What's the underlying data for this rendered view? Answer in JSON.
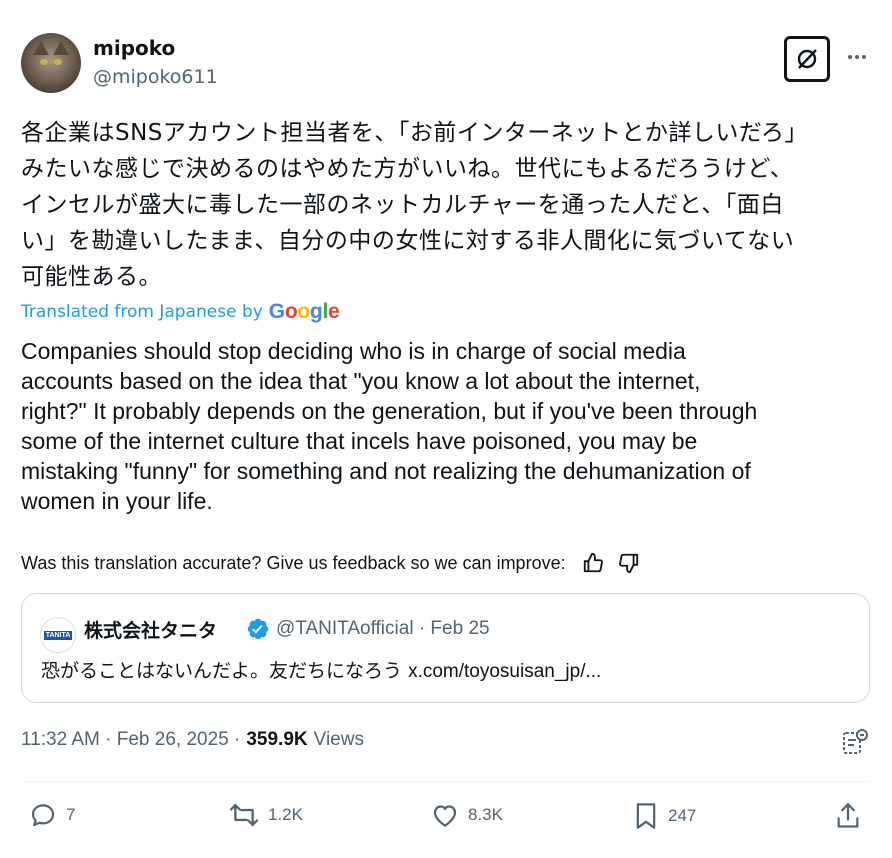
{
  "author": {
    "display_name": "mipoko",
    "handle": "@mipoko611"
  },
  "post": {
    "text_original": "各企業はSNSアカウント担当者を、「お前インターネットとか詳しいだろ」\nみたいな感じで決めるのはやめた方がいいね。世代にもよるだろうけど、\nインセルが盛大に毒した一部のネットカルチャーを通った人だと、「面白\nい」を勘違いしたまま、自分の中の女性に対する非人間化に気づいてない\n可能性ある。",
    "translated_from_label": "Translated from Japanese by",
    "translator_logo": "Google",
    "text_translation": "Companies should stop deciding who is in charge of social media\naccounts based on the idea that \"you know a lot about the internet,\nright?\" It probably depends on the generation, but if you've been through\nsome of the internet culture that incels have poisoned, you may be\nmistaking \"funny\" for something and not realizing the dehumanization of\nwomen in your life.",
    "feedback_prompt": "Was this translation accurate? Give us feedback so we can improve:"
  },
  "quote": {
    "avatar_text": "TANITA",
    "name": "株式会社タニタ",
    "handle_date": "@TANITAofficial · Feb 25",
    "text": "恐がることはないんだよ。友だちになろう",
    "link": "x.com/toyosuisan_jp/..."
  },
  "meta": {
    "timestamp": "11:32 AM · Feb 26, 2025 ·",
    "views_count": "359.9K",
    "views_label": "Views"
  },
  "actions": {
    "replies": "7",
    "reposts": "1.2K",
    "likes": "8.3K",
    "bookmarks": "247"
  },
  "colors": {
    "text": "#0f1419",
    "secondary": "#536471",
    "accent": "#1d9bf0",
    "border": "#cfd9de"
  },
  "icons": [
    "grok-icon",
    "more-icon",
    "thumbs-up-icon",
    "thumbs-down-icon",
    "verified-badge-icon",
    "analytics-icon",
    "reply-icon",
    "repost-icon",
    "like-icon",
    "bookmark-icon",
    "share-icon"
  ]
}
